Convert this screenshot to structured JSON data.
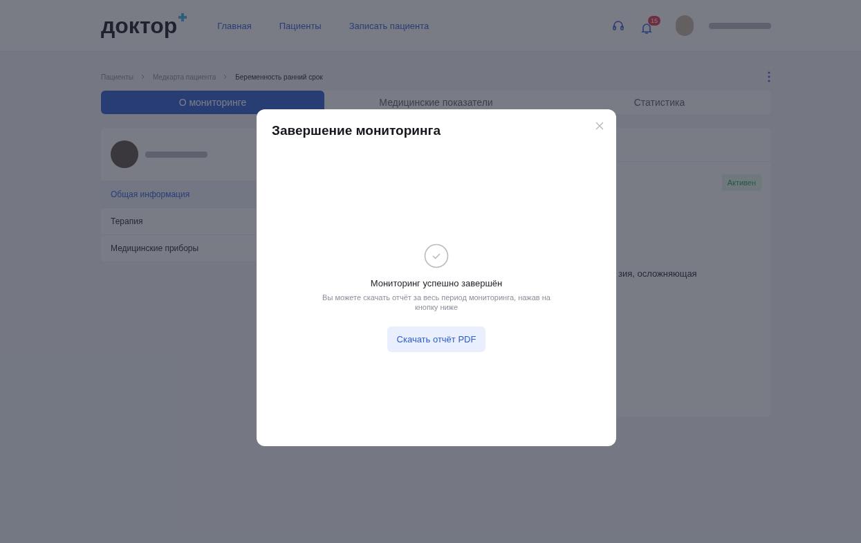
{
  "header": {
    "logo": "доктор",
    "nav": [
      "Главная",
      "Пациенты",
      "Записать пациента"
    ],
    "notification_count": "15"
  },
  "breadcrumbs": [
    "Пациенты",
    "Медкарта пациента",
    "Беременность ранний срок"
  ],
  "tabs": [
    {
      "label": "О мониторинге",
      "selected": true
    },
    {
      "label": "Медицинские показатели",
      "selected": false
    },
    {
      "label": "Статистика",
      "selected": false
    }
  ],
  "sidebar": {
    "items": [
      {
        "label": "Общая информация",
        "selected": true
      },
      {
        "label": "Терапия",
        "selected": false
      },
      {
        "label": "Медицинские приборы",
        "selected": false
      }
    ]
  },
  "details": {
    "status": "Активен",
    "text": "зия, осложняющая"
  },
  "modal": {
    "title": "Завершение мониторинга",
    "message_title": "Мониторинг успешно завершён",
    "message": "Вы можете скачать отчёт за весь период мониторинга, нажав на кнопку ниже",
    "button": "Скачать отчёт PDF"
  }
}
